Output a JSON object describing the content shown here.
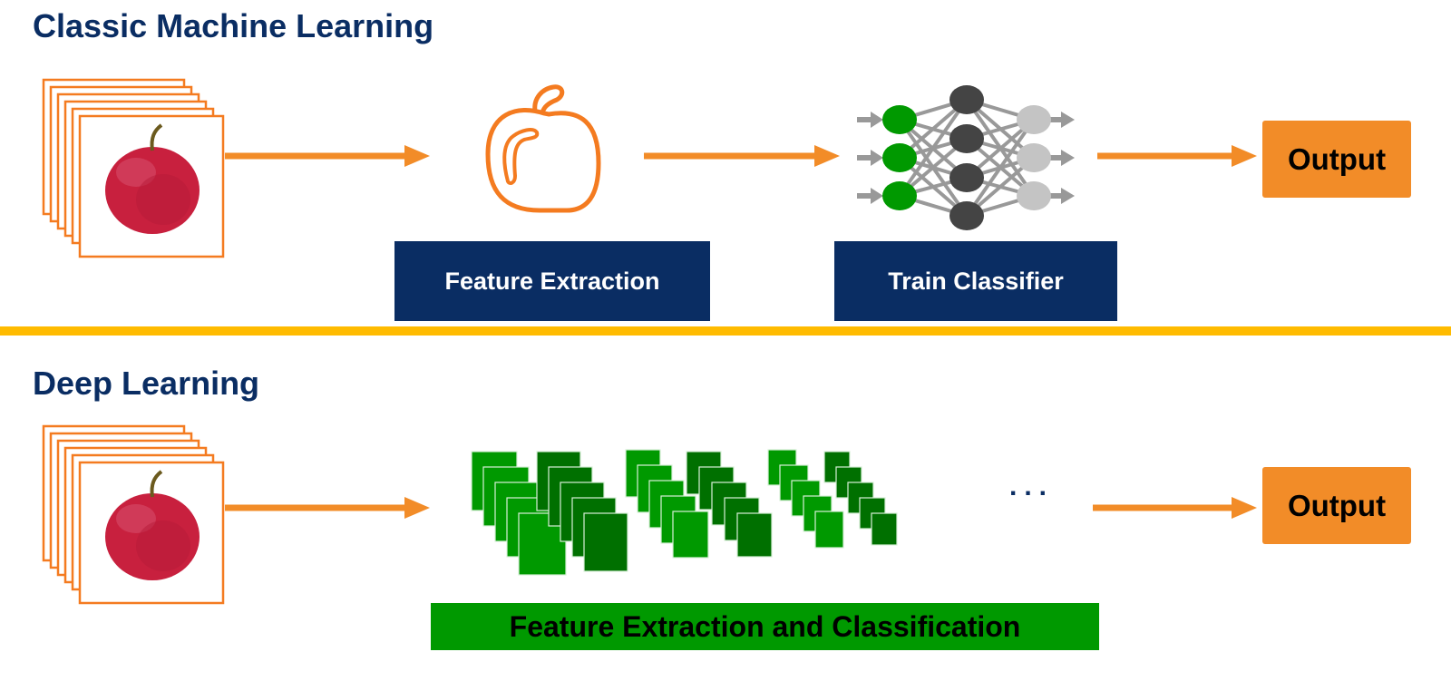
{
  "classic": {
    "title": "Classic Machine Learning",
    "input_icon": "apple-photo-stack-icon",
    "feature_icon": "apple-outline-icon",
    "classifier_icon": "neural-network-icon",
    "feature_label": "Feature Extraction",
    "classifier_label": "Train Classifier",
    "output_label": "Output"
  },
  "deep": {
    "title": "Deep Learning",
    "input_icon": "apple-photo-stack-icon",
    "layers_icon": "convolutional-layers-icon",
    "ellipsis": "...",
    "bar_label": "Feature Extraction and Classification",
    "output_label": "Output"
  },
  "colors": {
    "navy": "#0a2d63",
    "orange": "#f28c28",
    "divider_yellow": "#ffbb00",
    "green_light": "#009900",
    "green_dark": "#007000",
    "node_gray_dark": "#444444",
    "node_gray_light": "#c4c4c4"
  }
}
